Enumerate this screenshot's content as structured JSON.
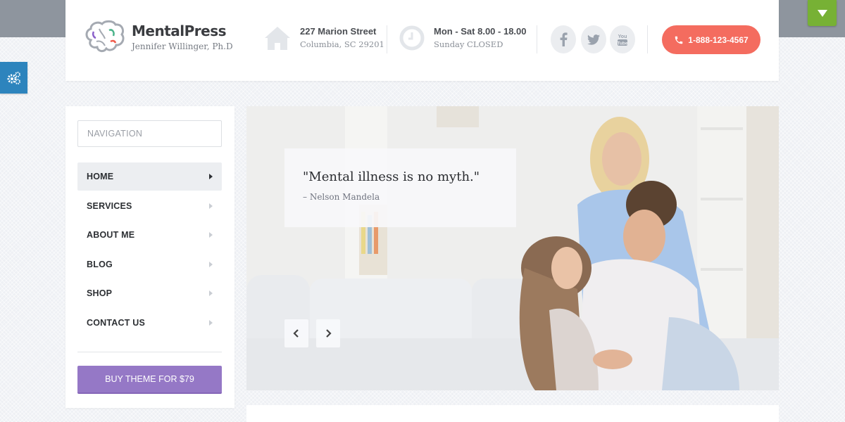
{
  "header": {
    "logo_name": "MentalPress",
    "logo_subtitle": "Jennifer Willinger, Ph.D",
    "address": {
      "icon": "home-icon",
      "line1": "227 Marion Street",
      "line2": "Columbia, SC 29201"
    },
    "hours": {
      "icon": "clock-icon",
      "line1": "Mon - Sat 8.00 - 18.00",
      "line2": "Sunday CLOSED"
    },
    "social": [
      {
        "icon": "facebook-icon",
        "label": "f"
      },
      {
        "icon": "twitter-icon",
        "label": "twitter"
      },
      {
        "icon": "youtube-icon",
        "label": "You Tube"
      }
    ],
    "phone": {
      "icon": "phone-icon",
      "label": "1-888-123-4567"
    }
  },
  "sidebar": {
    "nav_placeholder": "NAVIGATION",
    "items": [
      {
        "label": "HOME",
        "active": true
      },
      {
        "label": "SERVICES",
        "active": false
      },
      {
        "label": "ABOUT ME",
        "active": false
      },
      {
        "label": "BLOG",
        "active": false
      },
      {
        "label": "SHOP",
        "active": false
      },
      {
        "label": "CONTACT US",
        "active": false
      }
    ],
    "buy_button": "BUY THEME FOR $79"
  },
  "hero": {
    "quote": "\"Mental illness is no myth.\"",
    "author": "– Nelson Mandela",
    "prev_label": "‹",
    "next_label": "›",
    "image_description": "Smiling family with mother, father and daughter on a white sofa"
  },
  "colors": {
    "phone_button": "#f46c5f",
    "buy_button": "#9578c6",
    "gear_tab": "#2d84bd",
    "dropdown_tab": "#77b135"
  }
}
